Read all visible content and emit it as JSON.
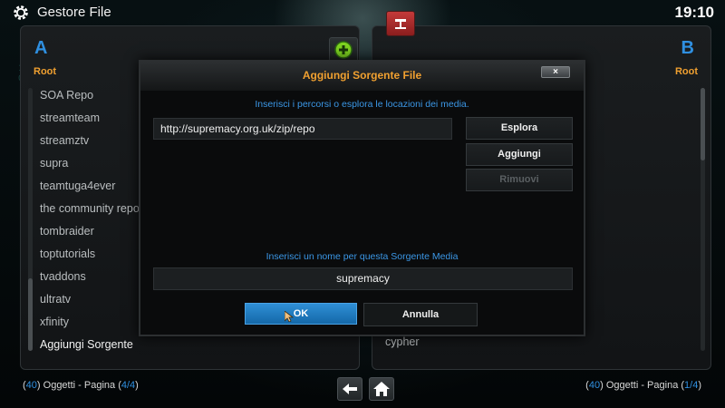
{
  "header": {
    "title": "Gestore File",
    "clock": "19:10"
  },
  "left_panel": {
    "letter": "A",
    "path": "Root",
    "items": [
      "SOA Repo",
      "streamteam",
      "streamztv",
      "supra",
      "teamtuga4ever",
      "the community repo",
      "tombraider",
      "toptutorials",
      "tvaddons",
      "ultratv",
      "xfinity",
      "Aggiungi Sorgente"
    ],
    "footer": {
      "count": "40",
      "mid": ") Oggetti - Pagina (",
      "page": "4/4"
    }
  },
  "right_panel": {
    "letter": "B",
    "path": "Root",
    "visible_item": "cypher",
    "footer": {
      "count": "40",
      "mid": ") Oggetti - Pagina (",
      "page": "1/4"
    }
  },
  "dialog": {
    "title": "Aggiungi Sorgente File",
    "close_label": "×",
    "paths_hint": "Inserisci i percorsi o esplora le locazioni dei media.",
    "path_value": "http://supremacy.org.uk/zip/repo",
    "browse_label": "Esplora",
    "add_label": "Aggiungi",
    "remove_label": "Rimuovi",
    "name_hint": "Inserisci un nome per questa Sorgente Media",
    "name_value": "supremacy",
    "ok_label": "OK",
    "cancel_label": "Annulla"
  },
  "colors": {
    "accent_blue": "#2f8fe0",
    "accent_orange": "#f0a030",
    "ok_button": "#1f7ec4"
  },
  "icons": [
    "gear-icon",
    "add-source-icon",
    "favourites-icon",
    "back-arrow-icon",
    "home-icon",
    "mouse-cursor-icon"
  ]
}
